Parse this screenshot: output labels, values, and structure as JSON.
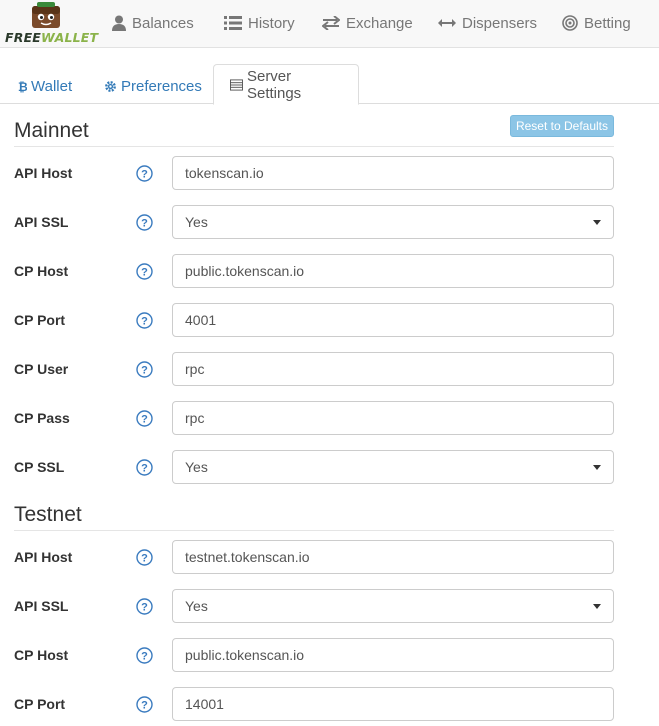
{
  "app": {
    "logo_word1": "FREE",
    "logo_word2": "WALLET"
  },
  "nav": {
    "items": [
      {
        "label": "Balances",
        "icon": "user-icon"
      },
      {
        "label": "History",
        "icon": "list-icon"
      },
      {
        "label": "Exchange",
        "icon": "exchange-icon"
      },
      {
        "label": "Dispensers",
        "icon": "arrows-horizontal-icon"
      },
      {
        "label": "Betting",
        "icon": "target-icon"
      }
    ]
  },
  "tabs": [
    {
      "label": "Wallet",
      "icon": "bitcoin-icon",
      "active": false
    },
    {
      "label": "Preferences",
      "icon": "gear-icon",
      "active": false
    },
    {
      "label": "Server Settings",
      "icon": "server-list-icon",
      "active": true
    }
  ],
  "reset_label": "Reset to Defaults",
  "mainnet": {
    "title": "Mainnet",
    "rows": [
      {
        "label": "API Host",
        "value": "tokenscan.io",
        "type": "input"
      },
      {
        "label": "API SSL",
        "value": "Yes",
        "type": "select"
      },
      {
        "label": "CP Host",
        "value": "public.tokenscan.io",
        "type": "input"
      },
      {
        "label": "CP Port",
        "value": "4001",
        "type": "input"
      },
      {
        "label": "CP User",
        "value": "rpc",
        "type": "input"
      },
      {
        "label": "CP Pass",
        "value": "rpc",
        "type": "input"
      },
      {
        "label": "CP SSL",
        "value": "Yes",
        "type": "select"
      }
    ]
  },
  "testnet": {
    "title": "Testnet",
    "rows": [
      {
        "label": "API Host",
        "value": "testnet.tokenscan.io",
        "type": "input"
      },
      {
        "label": "API SSL",
        "value": "Yes",
        "type": "select"
      },
      {
        "label": "CP Host",
        "value": "public.tokenscan.io",
        "type": "input"
      },
      {
        "label": "CP Port",
        "value": "14001",
        "type": "input"
      }
    ]
  },
  "colors": {
    "link": "#337ab7",
    "help": "#3a7bbf",
    "reset_bg": "#8cc5e6"
  }
}
